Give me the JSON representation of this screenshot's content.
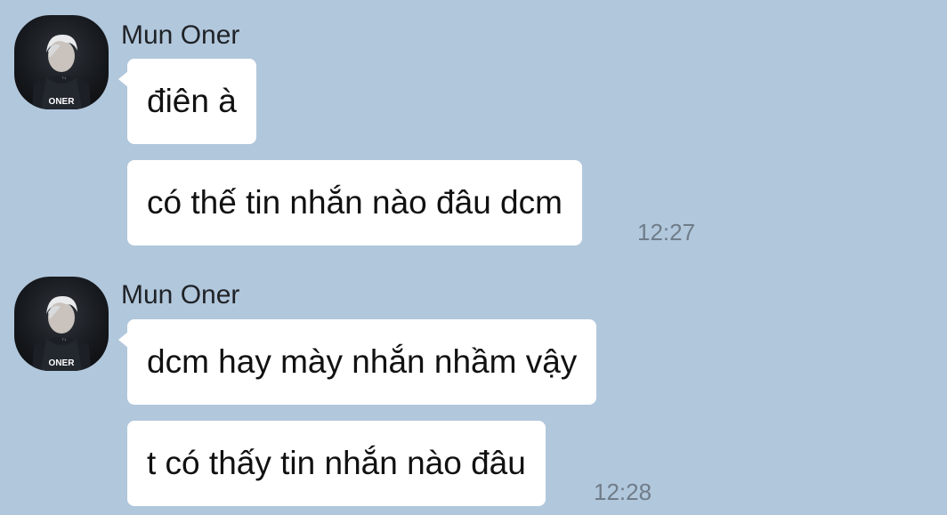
{
  "colors": {
    "background": "#b1c7dc",
    "bubble": "#ffffff",
    "timestamp": "#6f7c89"
  },
  "groups": [
    {
      "sender": "Mun Oner",
      "avatar_icon": "player-avatar-icon",
      "avatar_label": "ONER",
      "messages": [
        {
          "text": "điên à"
        },
        {
          "text": "có thế tin nhắn nào đâu dcm"
        }
      ],
      "time": "12:27"
    },
    {
      "sender": "Mun Oner",
      "avatar_icon": "player-avatar-icon",
      "avatar_label": "ONER",
      "messages": [
        {
          "text": "dcm hay mày nhắn nhầm vậy"
        },
        {
          "text": "t có thấy tin nhắn nào đâu"
        }
      ],
      "time": "12:28"
    }
  ]
}
